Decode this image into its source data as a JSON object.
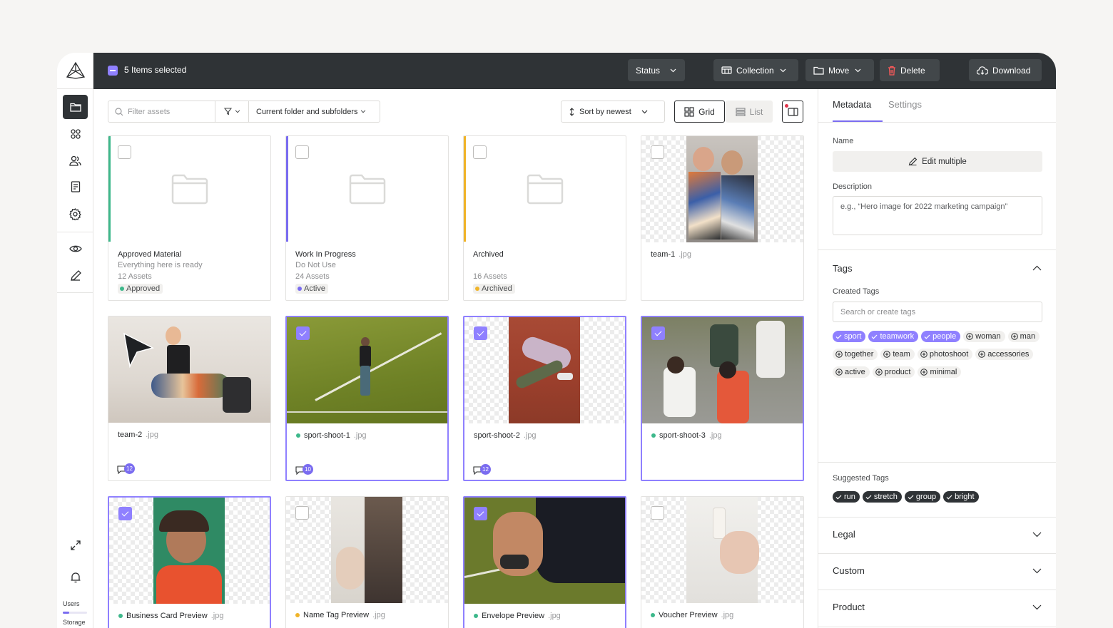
{
  "topbar": {
    "selection": "5 Items selected",
    "status": "Status",
    "collection": "Collection",
    "move": "Move",
    "delete": "Delete",
    "download": "Download"
  },
  "toolbar": {
    "filter_placeholder": "Filter assets",
    "scope": "Current folder and subfolders",
    "sort": "Sort by newest",
    "grid": "Grid",
    "list": "List"
  },
  "rail": {
    "users_label": "Users",
    "storage_label": "Storage",
    "users_fill": 0.25
  },
  "folders": [
    {
      "title": "Approved Material",
      "subtitle": "Everything here is ready",
      "count": "12 Assets",
      "status": "Approved",
      "color": "#3db88b"
    },
    {
      "title": "Work In Progress",
      "subtitle": "Do Not Use",
      "count": "24 Assets",
      "status": "Active",
      "color": "#7a6cf0"
    },
    {
      "title": "Archived",
      "subtitle": "",
      "count": "16 Assets",
      "status": "Archived",
      "color": "#f0b429"
    }
  ],
  "assets": [
    {
      "name": "team-1",
      "ext": ".jpg",
      "selected": false
    },
    {
      "name": "team-2",
      "ext": ".jpg",
      "selected": false,
      "comments": "12"
    },
    {
      "name": "sport-shoot-1",
      "ext": ".jpg",
      "selected": true,
      "comments": "10"
    },
    {
      "name": "sport-shoot-2",
      "ext": ".jpg",
      "selected": true,
      "comments": "12"
    },
    {
      "name": "sport-shoot-3",
      "ext": ".jpg",
      "selected": true
    },
    {
      "name": "Business Card Preview",
      "ext": ".jpg",
      "selected": true
    },
    {
      "name": "Name Tag Preview",
      "ext": ".jpg",
      "selected": false
    },
    {
      "name": "Envelope Preview",
      "ext": ".jpg",
      "selected": true
    },
    {
      "name": "Voucher Preview",
      "ext": ".jpg",
      "selected": false
    }
  ],
  "colors": {
    "accent": "#8f80ff",
    "dark": "#2f3336",
    "green": "#3db88b",
    "yellow": "#f0b429",
    "red": "#e0344a"
  },
  "panel": {
    "tab_metadata": "Metadata",
    "tab_settings": "Settings",
    "name_label": "Name",
    "edit_multiple": "Edit multiple",
    "description_label": "Description",
    "description_placeholder": "e.g., “Hero image for 2022 marketing campaign”",
    "tags_heading": "Tags",
    "created_tags_label": "Created Tags",
    "tag_search_placeholder": "Search or create tags",
    "created_tags": [
      {
        "label": "sport",
        "on": true
      },
      {
        "label": "teamwork",
        "on": true
      },
      {
        "label": "people",
        "on": true
      },
      {
        "label": "woman",
        "on": false
      },
      {
        "label": "man",
        "on": false
      },
      {
        "label": "together",
        "on": false
      },
      {
        "label": "team",
        "on": false
      },
      {
        "label": "photoshoot",
        "on": false
      },
      {
        "label": "accessories",
        "on": false
      },
      {
        "label": "active",
        "on": false
      },
      {
        "label": "product",
        "on": false
      },
      {
        "label": "minimal",
        "on": false
      }
    ],
    "suggested_tags_label": "Suggested Tags",
    "suggested_tags": [
      "run",
      "stretch",
      "group",
      "bright"
    ],
    "legal": "Legal",
    "custom": "Custom",
    "product": "Product"
  }
}
